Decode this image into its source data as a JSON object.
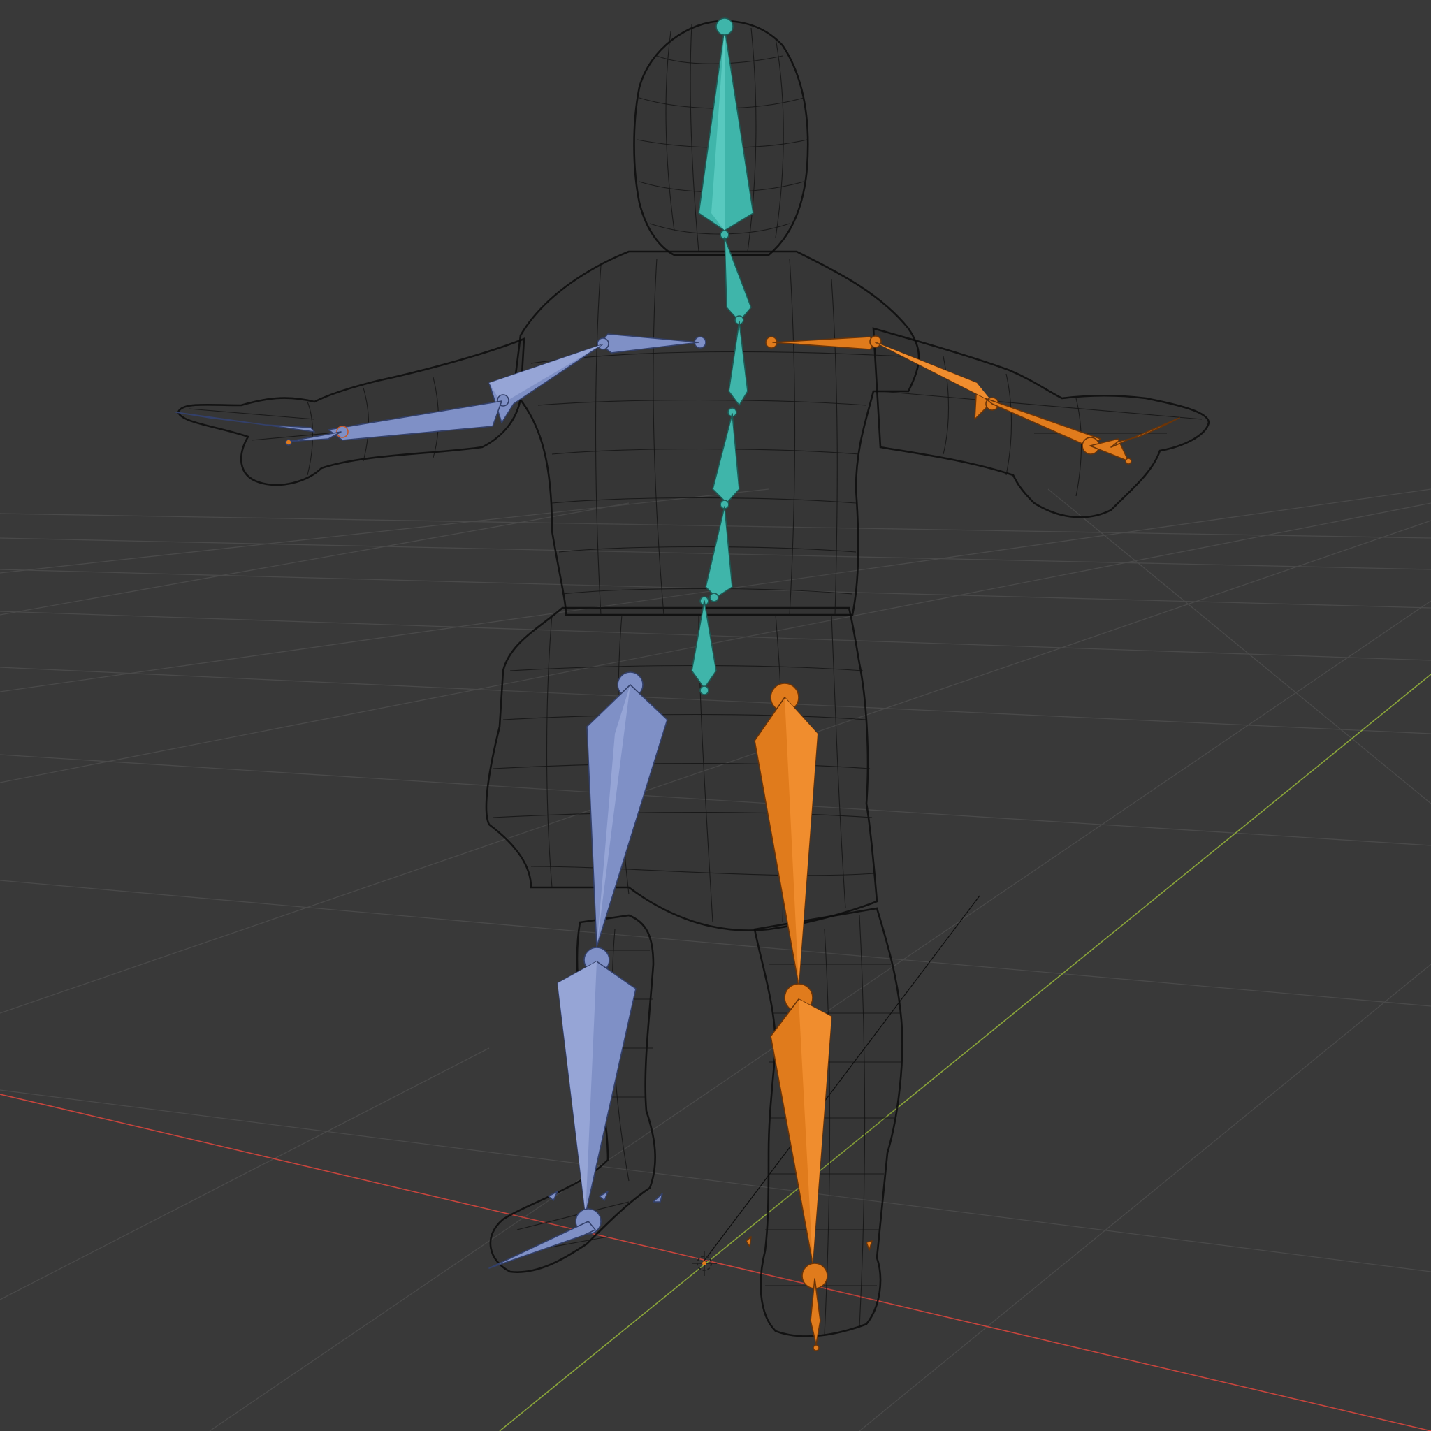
{
  "viewport": {
    "background": "#393939",
    "grid_color": "#4a4a4a",
    "axis_x_color": "#c8453d",
    "axis_y_color": "#8aa43a"
  },
  "mesh": {
    "wire_color": "#141414"
  },
  "armature": {
    "center_bone_color": "#3fb5aa",
    "left_bone_color": "#7f90c6",
    "right_bone_color": "#e07b1c",
    "groups": [
      "spine",
      "left-arm",
      "right-arm",
      "left-leg",
      "right-leg"
    ]
  },
  "scene": {
    "origin_marker": "3d-cursor-icon"
  }
}
